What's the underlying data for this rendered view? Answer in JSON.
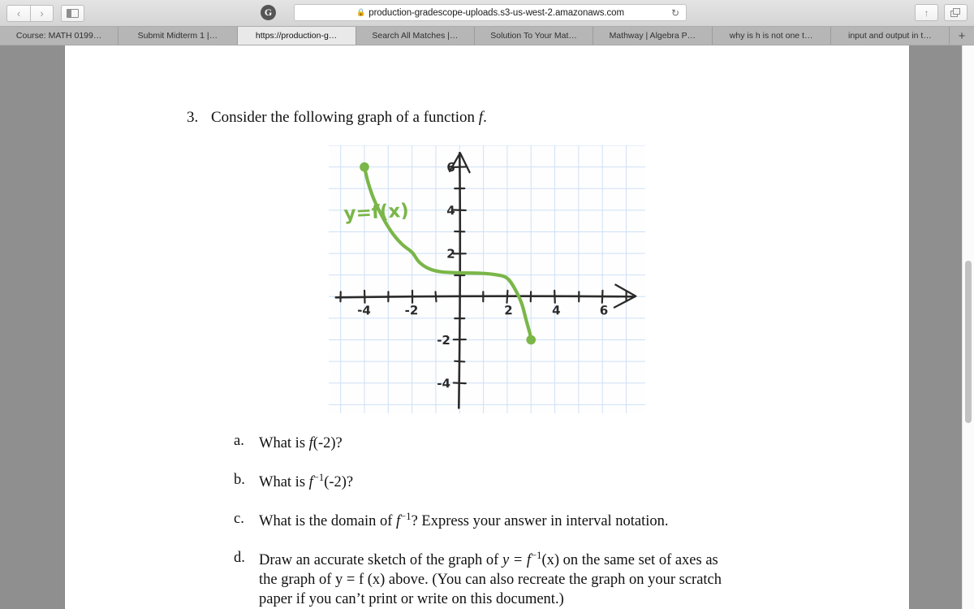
{
  "browser": {
    "back_label": "‹",
    "forward_label": "›",
    "sidebar_icon": "sidebar-icon",
    "grammarly_label": "G",
    "url": "production-gradescope-uploads.s3-us-west-2.amazonaws.com",
    "lock_icon": "🔒",
    "reload_icon": "↻",
    "share_icon": "↑",
    "tabs_overview_icon": "copy-icon",
    "new_tab_label": "+",
    "tabs": [
      {
        "label": "Course: MATH 0199…",
        "active": false
      },
      {
        "label": "Submit Midterm 1 |…",
        "active": false
      },
      {
        "label": "https://production-g…",
        "active": true
      },
      {
        "label": "Search All Matches |…",
        "active": false
      },
      {
        "label": "Solution To Your Mat…",
        "active": false
      },
      {
        "label": "Mathway | Algebra P…",
        "active": false
      },
      {
        "label": "why is h is not one t…",
        "active": false
      },
      {
        "label": "input and output in t…",
        "active": false
      }
    ]
  },
  "document": {
    "question_number": "3.",
    "question_prompt_pre": "Consider the following graph of a function ",
    "question_prompt_var": "f",
    "question_prompt_post": ".",
    "subquestions": [
      {
        "label": "a.",
        "text_pre": "What is ",
        "fn": "f",
        "sup": "",
        "text_post": "(-2)?",
        "line2": ""
      },
      {
        "label": "b.",
        "text_pre": "What is ",
        "fn": "f",
        "sup": "−1",
        "text_post": "(-2)?",
        "line2": ""
      },
      {
        "label": "c.",
        "text_pre": "What is the domain of ",
        "fn": "f",
        "sup": "−1",
        "text_post": "? Express your answer in interval notation.",
        "line2": ""
      },
      {
        "label": "d.",
        "text_pre": "Draw an accurate sketch of the graph of ",
        "fn": "y = f",
        "sup": "−1",
        "text_post": "(x) on the same set of axes as",
        "line2": "the graph of y = f (x) above. (You can also recreate the graph on your scratch",
        "line3": "paper if you can’t print or write on this document.)"
      }
    ]
  },
  "chart_data": {
    "type": "line",
    "title": "",
    "subtitle": "",
    "xlabel": "",
    "ylabel": "",
    "annotation": "y=f(x)",
    "annotation_color": "#7ab648",
    "curve_color": "#7ab648",
    "axis_color": "#2a2a2a",
    "grid_color": "#cfe0f5",
    "grid": true,
    "grid_step": 1,
    "xlim": [
      -5.5,
      7.8
    ],
    "ylim": [
      -5.4,
      7.0
    ],
    "x_ticks": [
      -5,
      -4,
      -3,
      -2,
      -1,
      1,
      2,
      3,
      4,
      5,
      6,
      7
    ],
    "y_ticks": [
      -4,
      -3,
      -2,
      -1,
      1,
      2,
      3,
      4,
      5,
      6
    ],
    "x_tick_labels": [
      {
        "value": -4,
        "text": "-4"
      },
      {
        "value": -2,
        "text": "-2"
      },
      {
        "value": 2,
        "text": "2"
      },
      {
        "value": 4,
        "text": "4"
      },
      {
        "value": 6,
        "text": "6"
      }
    ],
    "y_tick_labels": [
      {
        "value": 6,
        "text": "6"
      },
      {
        "value": 4,
        "text": "4"
      },
      {
        "value": 2,
        "text": "2"
      },
      {
        "value": -2,
        "text": "-2"
      },
      {
        "value": -4,
        "text": "-4"
      }
    ],
    "endpoints": [
      {
        "x": -4,
        "y": 6,
        "filled": true
      },
      {
        "x": 3,
        "y": -2,
        "filled": true
      }
    ],
    "points": [
      {
        "x": -4.0,
        "y": 6.0
      },
      {
        "x": -3.85,
        "y": 5.3
      },
      {
        "x": -3.6,
        "y": 4.5
      },
      {
        "x": -3.2,
        "y": 3.6
      },
      {
        "x": -2.8,
        "y": 2.9
      },
      {
        "x": -2.4,
        "y": 2.4
      },
      {
        "x": -2.0,
        "y": 2.05
      },
      {
        "x": -1.7,
        "y": 1.6
      },
      {
        "x": -1.3,
        "y": 1.3
      },
      {
        "x": -0.8,
        "y": 1.15
      },
      {
        "x": 0.0,
        "y": 1.1
      },
      {
        "x": 0.9,
        "y": 1.08
      },
      {
        "x": 1.6,
        "y": 1.0
      },
      {
        "x": 2.0,
        "y": 0.85
      },
      {
        "x": 2.3,
        "y": 0.4
      },
      {
        "x": 2.6,
        "y": -0.3
      },
      {
        "x": 2.8,
        "y": -1.1
      },
      {
        "x": 2.95,
        "y": -1.7
      },
      {
        "x": 3.0,
        "y": -2.0
      }
    ]
  }
}
